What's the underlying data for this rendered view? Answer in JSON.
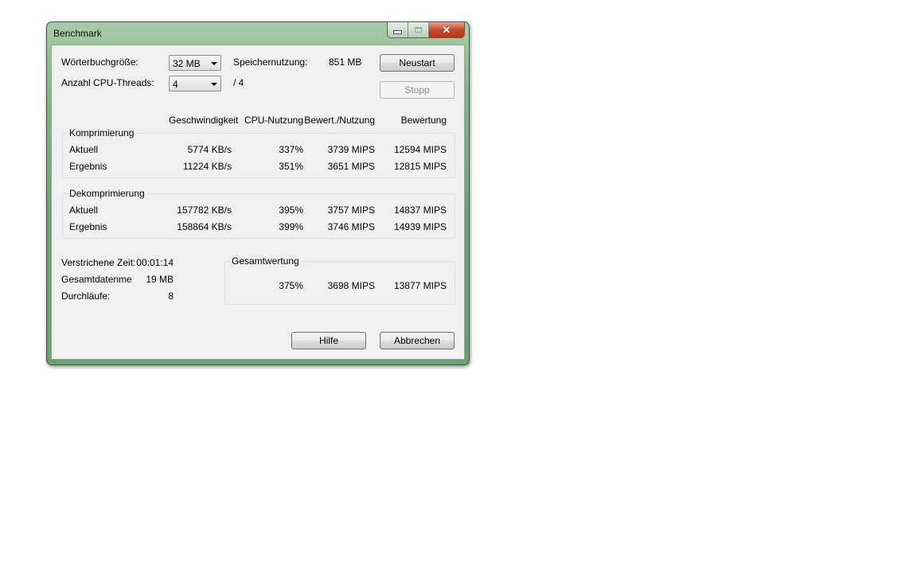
{
  "window": {
    "title": "Benchmark"
  },
  "settings": {
    "dict_label": "Wörterbuchgröße:",
    "dict_value": "32 MB",
    "threads_label": "Anzahl CPU-Threads:",
    "threads_value": "4",
    "threads_total": "/ 4",
    "memory_label": "Speichernutzung:",
    "memory_value": "851 MB"
  },
  "buttons": {
    "restart": "Neustart",
    "stop": "Stopp",
    "help": "Hilfe",
    "cancel": "Abbrechen"
  },
  "columns": {
    "speed": "Geschwindigkeit",
    "cpu": "CPU-Nutzung",
    "rating_usage": "Bewert./Nutzung",
    "rating": "Bewertung"
  },
  "compression": {
    "title": "Komprimierung",
    "rows": [
      {
        "label": "Aktuell",
        "speed": "5774 KB/s",
        "cpu": "337%",
        "rating_usage": "3739 MIPS",
        "rating": "12594 MIPS"
      },
      {
        "label": "Ergebnis",
        "speed": "11224 KB/s",
        "cpu": "351%",
        "rating_usage": "3651 MIPS",
        "rating": "12815 MIPS"
      }
    ]
  },
  "decompression": {
    "title": "Dekomprimierung",
    "rows": [
      {
        "label": "Aktuell",
        "speed": "157782 KB/s",
        "cpu": "395%",
        "rating_usage": "3757 MIPS",
        "rating": "14837 MIPS"
      },
      {
        "label": "Ergebnis",
        "speed": "158864 KB/s",
        "cpu": "399%",
        "rating_usage": "3746 MIPS",
        "rating": "14939 MIPS"
      }
    ]
  },
  "stats": {
    "elapsed_label": "Verstrichene Zeit:",
    "elapsed_value": "00:01:14",
    "data_label": "Gesamtdatenmeng",
    "data_value": "19 MB",
    "passes_label": "Durchläufe:",
    "passes_value": "8"
  },
  "total": {
    "title": "Gesamtwertung",
    "cpu": "375%",
    "rating_usage": "3698 MIPS",
    "rating": "13877 MIPS"
  },
  "icons": {
    "minimize": "minimize-icon",
    "maximize": "maximize-icon",
    "close": "close-icon",
    "dropdown": "chevron-down-icon"
  }
}
